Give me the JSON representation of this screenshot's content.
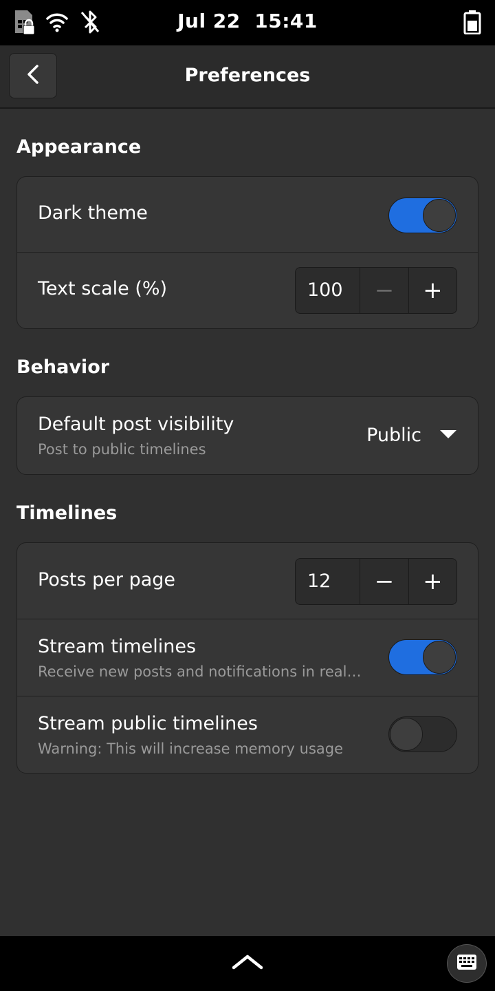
{
  "status_bar": {
    "date": "Jul 22",
    "time": "15:41",
    "icons": [
      "sim-locked-icon",
      "wifi-icon",
      "bluetooth-disabled-icon",
      "battery-icon"
    ]
  },
  "header": {
    "title": "Preferences",
    "back_icon": "chevron-left-icon"
  },
  "sections": {
    "appearance": {
      "title": "Appearance",
      "dark_theme": {
        "label": "Dark theme",
        "enabled": true
      },
      "text_scale": {
        "label": "Text scale (%)",
        "value": "100",
        "decrement": "−",
        "increment": "+"
      }
    },
    "behavior": {
      "title": "Behavior",
      "post_visibility": {
        "label": "Default post visibility",
        "subtitle": "Post to public timelines",
        "value": "Public"
      }
    },
    "timelines": {
      "title": "Timelines",
      "posts_per_page": {
        "label": "Posts per page",
        "value": "12",
        "decrement": "−",
        "increment": "+"
      },
      "stream_timelines": {
        "label": "Stream timelines",
        "subtitle": "Receive new posts and notifications in real…",
        "enabled": true
      },
      "stream_public": {
        "label": "Stream public timelines",
        "subtitle": "Warning: This will increase memory usage",
        "enabled": false
      }
    }
  },
  "colors": {
    "accent": "#1f6ee0",
    "background": "#303030",
    "card": "#363636"
  }
}
